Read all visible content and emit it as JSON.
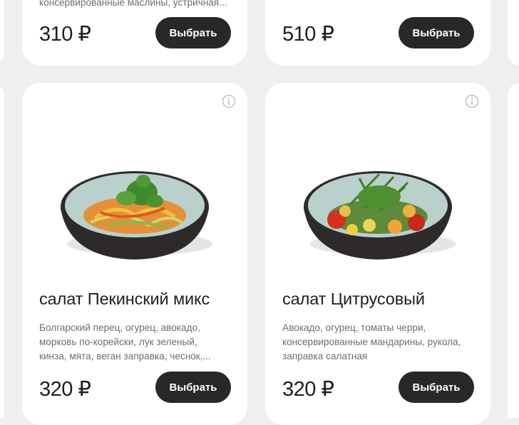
{
  "top_cards": [
    {
      "desc_tail": "консервированные маслины, устричная...",
      "price": "310 ₽",
      "button": "Выбрать"
    },
    {
      "desc_tail": "",
      "price": "510 ₽",
      "button": "Выбрать"
    }
  ],
  "cards": [
    {
      "title": "салат Пекинский микс",
      "description_lines": [
        "Болгарский перец, огурец, авокадо,",
        "морковь по-корейски, лук зеленый,",
        "кинза, мята, веган заправка, чеснок,..."
      ],
      "price": "320 ₽",
      "button": "Выбрать",
      "info_icon": "info-icon"
    },
    {
      "title": "салат Цитрусовый",
      "description_lines": [
        "Авокадо, огурец, томаты черри,",
        "консервированные мандарины, рукола,",
        "заправка салатная"
      ],
      "price": "320 ₽",
      "button": "Выбрать",
      "info_icon": "info-icon"
    }
  ],
  "colors": {
    "background": "#efefef",
    "card": "#ffffff",
    "button": "#282828",
    "description": "#6e6e6e"
  }
}
